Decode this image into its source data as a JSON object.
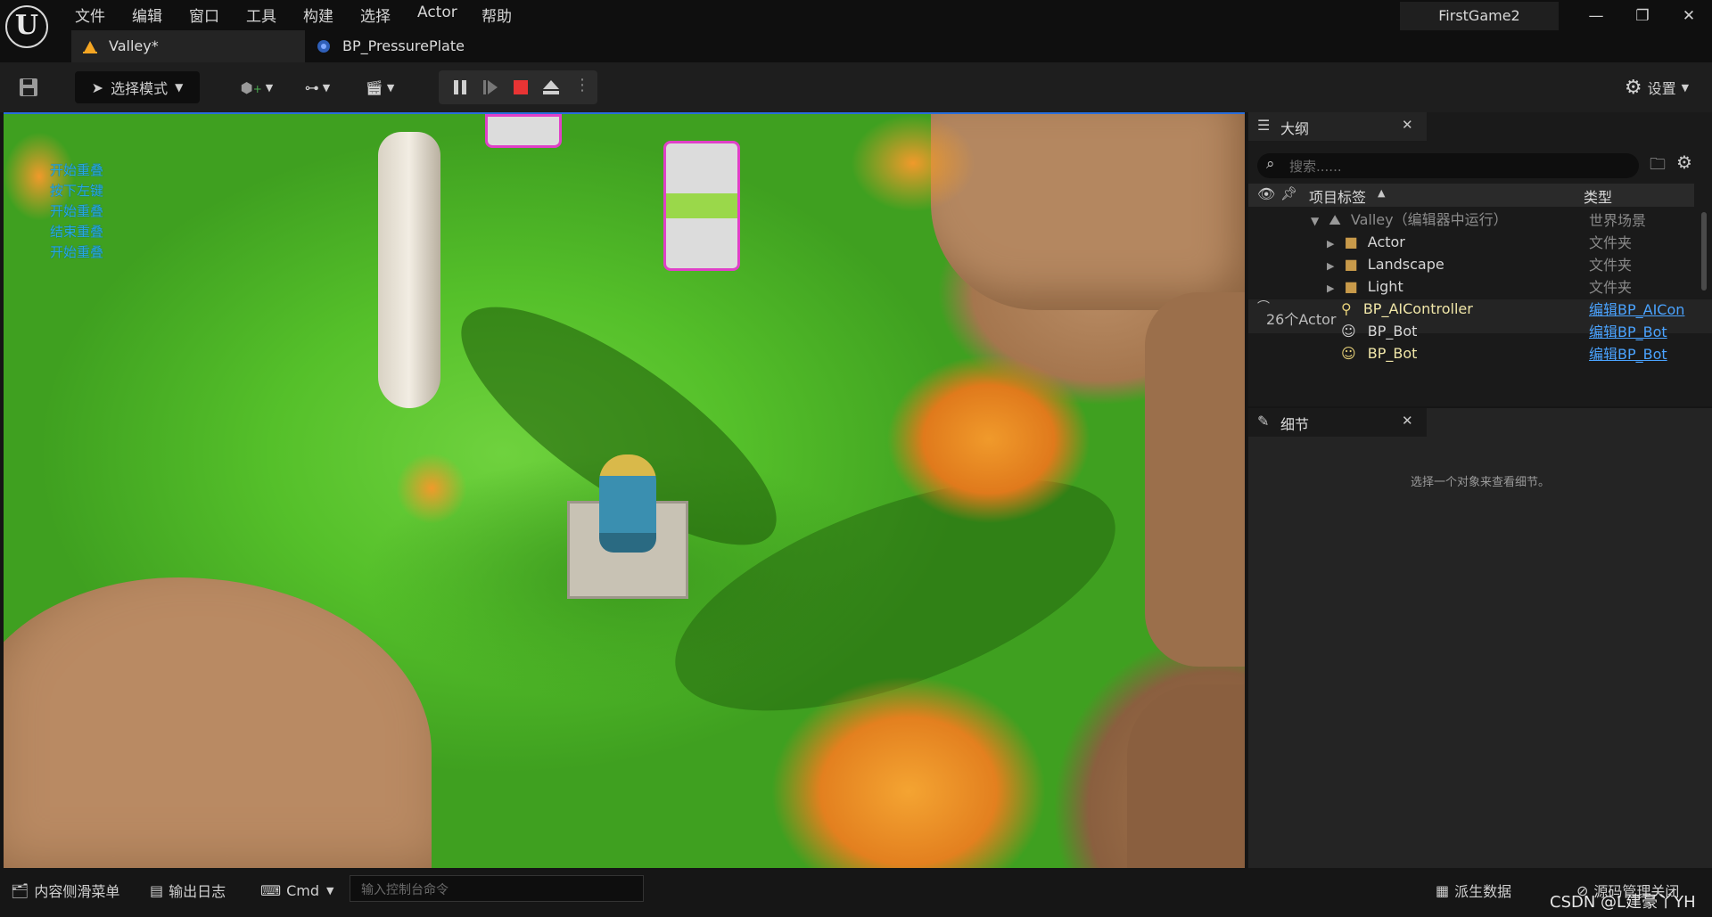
{
  "menu": [
    "文件",
    "编辑",
    "窗口",
    "工具",
    "构建",
    "选择",
    "Actor",
    "帮助"
  ],
  "project_name": "FirstGame2",
  "tabs": [
    {
      "label": "Valley*",
      "icon": "level-icon"
    },
    {
      "label": "BP_PressurePlate",
      "icon": "blueprint-icon"
    }
  ],
  "toolbar": {
    "mode_label": "选择模式",
    "settings_label": "设置"
  },
  "viewport": {
    "log_lines": [
      "开始重叠",
      "按下左键",
      "开始重叠",
      "结束重叠",
      "开始重叠"
    ]
  },
  "outliner": {
    "tab_label": "大纲",
    "search_placeholder": "搜索......",
    "col_label": "项目标签",
    "col_type": "类型",
    "rows": [
      {
        "label": "Valley（编辑器中运行）",
        "type": "世界场景",
        "indent": 0,
        "kind": "world"
      },
      {
        "label": "Actor",
        "type": "文件夹",
        "indent": 1,
        "kind": "folder"
      },
      {
        "label": "Landscape",
        "type": "文件夹",
        "indent": 1,
        "kind": "folder"
      },
      {
        "label": "Light",
        "type": "文件夹",
        "indent": 1,
        "kind": "folder"
      },
      {
        "label": "BP_AIController",
        "type": "编辑BP_AICon",
        "indent": 1,
        "kind": "controller"
      },
      {
        "label": "BP_Bot",
        "type": "编辑BP_Bot",
        "indent": 1,
        "kind": "pawn"
      },
      {
        "label": "BP_Bot",
        "type": "编辑BP_Bot",
        "indent": 1,
        "kind": "pawn"
      }
    ],
    "count_label": "26个Actor"
  },
  "details": {
    "tab_label": "细节",
    "empty_hint": "选择一个对象来查看细节。"
  },
  "statusbar": {
    "content_drawer": "内容侧滑菜单",
    "output_log": "输出日志",
    "cmd": "Cmd",
    "console_placeholder": "输入控制台命令",
    "derived_data": "派生数据",
    "source_control": "源码管理关闭",
    "watermark": "CSDN @L建豪丫YH"
  }
}
